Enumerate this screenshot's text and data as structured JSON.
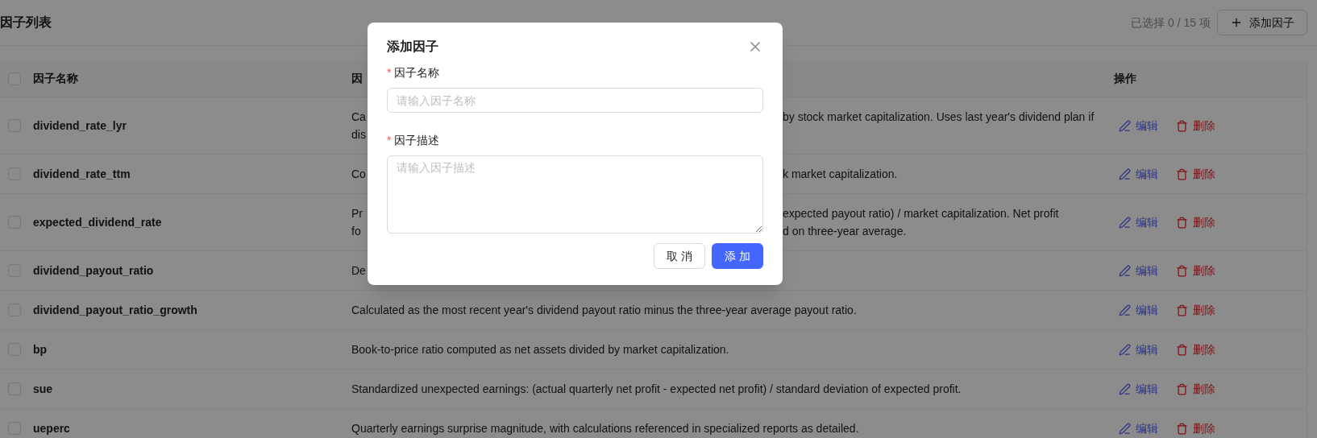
{
  "page": {
    "title": "因子列表",
    "selection_count": "已选择 0 / 15 项",
    "add_button": "添加因子"
  },
  "table": {
    "select_all": {
      "checked": false
    },
    "columns": [
      "因子名称",
      "因",
      "操作"
    ],
    "rows": [
      {
        "checked": false,
        "name": "dividend_rate_lyr",
        "description_lines": [
          {
            "start": "Ca",
            "end": "by stock market capitalization. Uses last year's dividend plan if"
          },
          {
            "start": "dis"
          }
        ],
        "edit": "编辑",
        "delete": "删除"
      },
      {
        "checked": false,
        "name": "dividend_rate_ttm",
        "description_lines": [
          {
            "start": "Co",
            "end": "k market capitalization."
          }
        ],
        "edit": "编辑",
        "delete": "删除"
      },
      {
        "checked": false,
        "name": "expected_dividend_rate",
        "description_lines": [
          {
            "start": "Pr",
            "end": "expected payout ratio) / market capitalization. Net profit"
          },
          {
            "start": "fo",
            "end": "d on three-year average."
          }
        ],
        "edit": "编辑",
        "delete": "删除"
      },
      {
        "checked": false,
        "name": "dividend_payout_ratio",
        "description_lines": [
          {
            "start": "De"
          }
        ],
        "edit": "编辑",
        "delete": "删除"
      },
      {
        "checked": false,
        "name": "dividend_payout_ratio_growth",
        "description_lines": [
          {
            "start": "Calculated as the most recent year's dividend payout ratio minus the three-year average payout ratio."
          }
        ],
        "edit": "编辑",
        "delete": "删除"
      },
      {
        "checked": false,
        "name": "bp",
        "description_lines": [
          {
            "start": "Book-to-price ratio computed as net assets divided by market capitalization."
          }
        ],
        "edit": "编辑",
        "delete": "删除"
      },
      {
        "checked": false,
        "name": "sue",
        "description_lines": [
          {
            "start": "Standardized unexpected earnings: (actual quarterly net profit - expected net profit) / standard deviation of expected profit."
          }
        ],
        "edit": "编辑",
        "delete": "删除"
      },
      {
        "checked": false,
        "name": "ueperc",
        "description_lines": [
          {
            "start": "Quarterly earnings surprise magnitude, with calculations referenced in specialized reports as detailed."
          }
        ],
        "edit": "编辑",
        "delete": "删除"
      }
    ]
  },
  "modal": {
    "title": "添加因子",
    "fields": [
      {
        "kind": "input",
        "label": "因子名称",
        "required_mark": "*",
        "placeholder": "请输入因子名称"
      },
      {
        "kind": "textarea",
        "label": "因子描述",
        "required_mark": "*",
        "placeholder": "请输入因子描述"
      }
    ],
    "buttons": [
      {
        "label": "取 消",
        "primary": false
      },
      {
        "label": "添 加",
        "primary": true
      }
    ]
  }
}
